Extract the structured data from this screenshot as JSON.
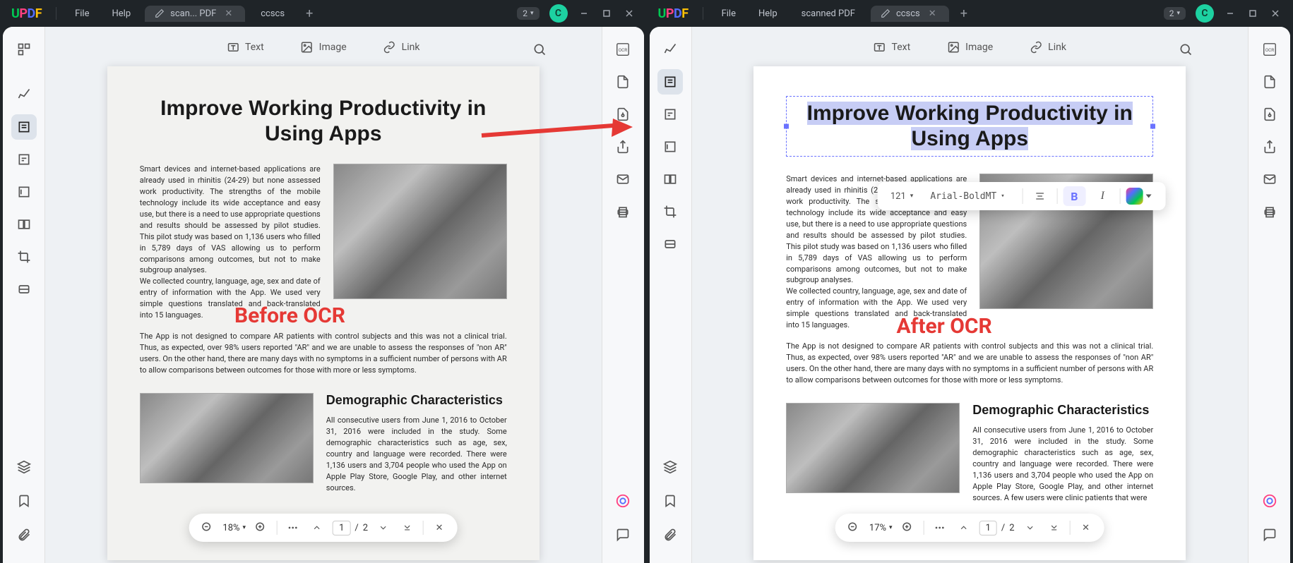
{
  "menu": {
    "file": "File",
    "help": "Help"
  },
  "tabs": {
    "left_active": "scan... PDF",
    "left_inactive": "ccscs",
    "right_inactive": "scanned PDF",
    "right_active": "ccscs"
  },
  "badge": "2",
  "user_initial": "C",
  "top_tools": {
    "text": "Text",
    "image": "Image",
    "link": "Link"
  },
  "doc": {
    "title": "Improve Working Productivity in Using Apps",
    "para1": "Smart devices and internet-based applications are already used in rhinitis (24-29) but none assessed work productivity. The strengths of the mobile technology include its wide acceptance and easy use, but there is a need to use appropriate questions and results should be assessed by pilot studies. This pilot study was based on 1,136 users who filled in 5,789 days of VAS allowing us to perform comparisons among outcomes, but not to make subgroup analyses.",
    "para1b": "We collected country, language, age, sex and date of entry of information with the App. We used very simple questions translated and back-translated into 15 languages.",
    "para2": "The App is not designed to compare AR patients with control subjects and this was not a clinical trial. Thus, as expected, over 98% users reported \"AR\" and we are unable to assess the responses of \"non AR\" users. On the other hand, there are many days with no symptoms in a sufficient number of persons with AR to allow comparisons between outcomes for those with more or less symptoms.",
    "h2": "Demographic Characteristics",
    "para3_left": "All consecutive users from June 1, 2016 to October 31, 2016 were included in the study. Some demographic characteristics such as age, sex, country and language were recorded. There were 1,136 users and 3,704 people who used the App on Apple Play Store, Google Play, and other internet sources.",
    "para3_right": "All consecutive users from June 1, 2016 to October 31, 2016 were included in the study. Some demographic characteristics such as age, sex, country and language were recorded. There were 1,136 users and 3,704 people who used the App on Apple Play Store, Google Play, and other internet sources. A few users were clinic patients that were"
  },
  "format": {
    "size": "121",
    "font": "Arial-BoldMT"
  },
  "page_controls": {
    "zoom_left": "18%",
    "zoom_right": "17%",
    "page_cur": "1",
    "page_total": "2"
  },
  "overlay": {
    "before": "Before OCR",
    "after": "After OCR"
  }
}
